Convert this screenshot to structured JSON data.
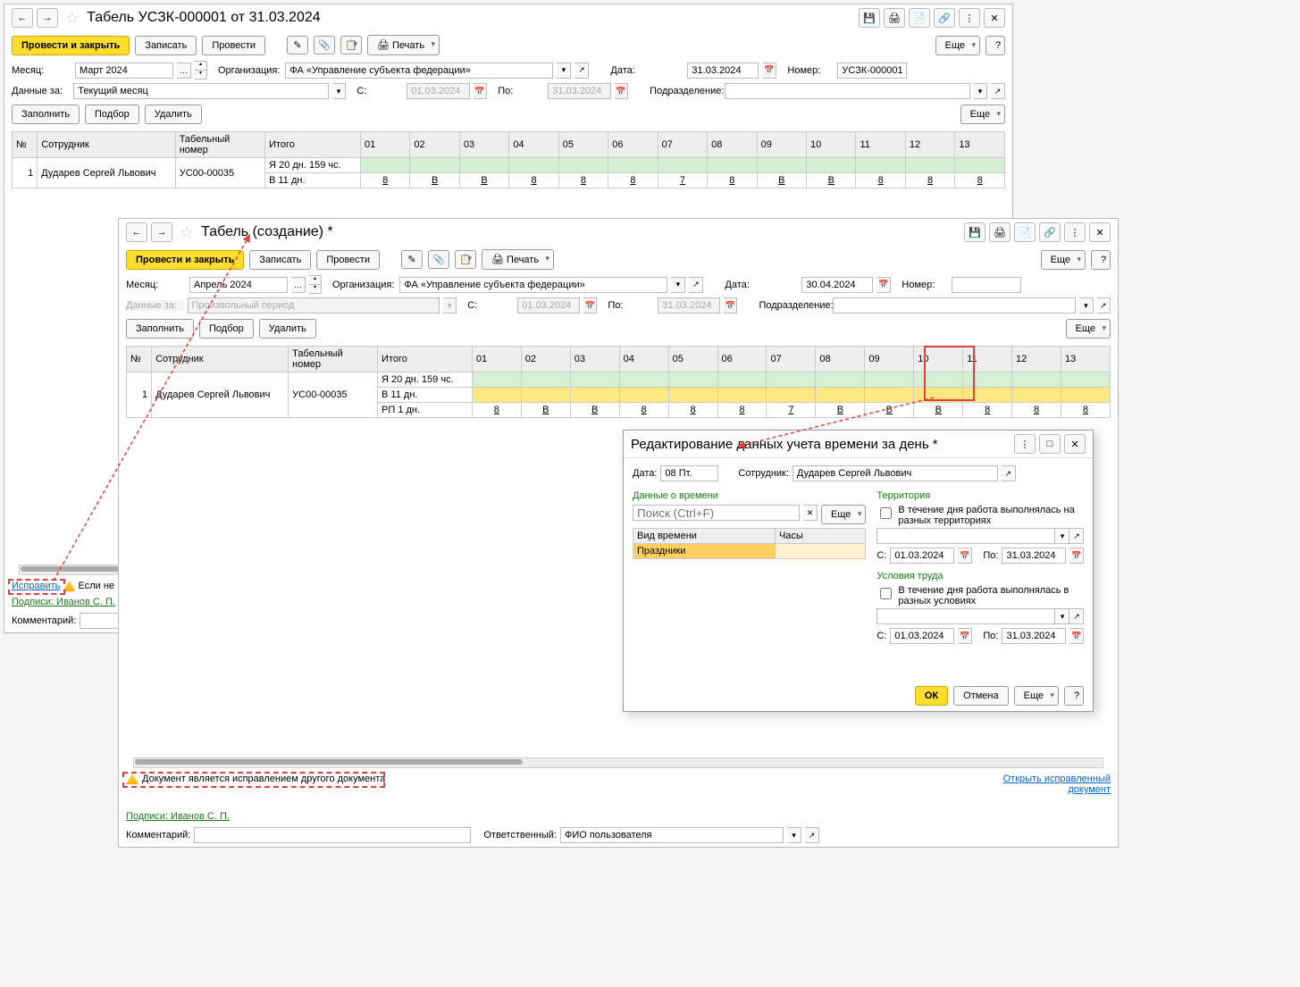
{
  "win1": {
    "title": "Табель УСЗК-000001 от 31.03.2024",
    "toolbar": {
      "post_close": "Провести и закрыть",
      "save": "Записать",
      "post": "Провести",
      "print": "Печать",
      "more": "Еще"
    },
    "form": {
      "month_label": "Месяц:",
      "month_value": "Март 2024",
      "org_label": "Организация:",
      "org_value": "ФА «Управление субъекта федерации»",
      "date_label": "Дата:",
      "date_value": "31.03.2024",
      "number_label": "Номер:",
      "number_value": "УСЗК-000001",
      "data_for_label": "Данные за:",
      "data_for_value": "Текущий месяц",
      "from_label": "С:",
      "from_value": "01.03.2024",
      "to_label": "По:",
      "to_value": "31.03.2024",
      "dept_label": "Подразделение:"
    },
    "tb2": {
      "fill": "Заполнить",
      "pick": "Подбор",
      "delete": "Удалить",
      "more": "Еще"
    },
    "grid": {
      "cols": {
        "n": "№",
        "emp": "Сотрудник",
        "tab": "Табельный номер",
        "sum": "Итого"
      },
      "days": [
        "01",
        "02",
        "03",
        "04",
        "05",
        "06",
        "07",
        "08",
        "09",
        "10",
        "11",
        "12",
        "13"
      ],
      "row": {
        "n": "1",
        "emp": "Дударев Сергей Львович",
        "tab": "УС00-00035",
        "sum1": "Я 20 дн. 159 чс.",
        "sum2": "В 11 дн.",
        "vals": [
          "8",
          "В",
          "В",
          "8",
          "8",
          "8",
          "7",
          "8",
          "В",
          "В",
          "8",
          "8",
          "8"
        ],
        "weekend_idx": [
          1,
          2,
          8,
          9
        ]
      }
    },
    "footer": {
      "fix": "Исправить",
      "warn": "Если не",
      "sign": "Подписи: Иванов С. П.",
      "comment_label": "Комментарий:"
    }
  },
  "win2": {
    "title": "Табель (создание) *",
    "toolbar": {
      "post_close": "Провести и закрыть",
      "save": "Записать",
      "post": "Провести",
      "print": "Печать",
      "more": "Еще"
    },
    "form": {
      "month_label": "Месяц:",
      "month_value": "Апрель 2024",
      "org_label": "Организация:",
      "org_value": "ФА «Управление субъекта федерации»",
      "date_label": "Дата:",
      "date_value": "30.04.2024",
      "number_label": "Номер:",
      "number_value": "",
      "data_for_label": "Данные за:",
      "data_for_value": "Произвольный период",
      "from_label": "С:",
      "from_value": "01.03.2024",
      "to_label": "По:",
      "to_value": "31.03.2024",
      "dept_label": "Подразделение:"
    },
    "tb2": {
      "fill": "Заполнить",
      "pick": "Подбор",
      "delete": "Удалить",
      "more": "Еще"
    },
    "grid": {
      "cols": {
        "n": "№",
        "emp": "Сотрудник",
        "tab": "Табельный номер",
        "sum": "Итого"
      },
      "days": [
        "01",
        "02",
        "03",
        "04",
        "05",
        "06",
        "07",
        "08",
        "09",
        "10",
        "11",
        "12",
        "13"
      ],
      "row": {
        "n": "1",
        "emp": "Дударев Сергей Львович",
        "tab": "УС00-00035",
        "sum1": "Я 20 дн. 159 чс.",
        "sum2": "В 11 дн.",
        "sum3": "РП 1 дн.",
        "vals": [
          "8",
          "В",
          "В",
          "8",
          "8",
          "8",
          "7",
          "В",
          "В",
          "В",
          "8",
          "8",
          "8"
        ],
        "weekend_idx": [
          1,
          2,
          8,
          9
        ],
        "highlight_idx": 7
      }
    },
    "footer": {
      "warn": "Документ является исправлением другого документа",
      "open_corr": "Открыть исправленный документ",
      "sign": "Подписи: Иванов С. П.",
      "comment_label": "Комментарий:",
      "resp_label": "Ответственный:",
      "resp_value": "ФИО пользователя"
    }
  },
  "modal": {
    "title": "Редактирование данных учета времени за день *",
    "date_label": "Дата:",
    "date_value": "08 Пт.",
    "emp_label": "Сотрудник:",
    "emp_value": "Дударев Сергей Львович",
    "time_section": "Данные о времени",
    "search_ph": "Поиск (Ctrl+F)",
    "more": "Еще",
    "col_type": "Вид времени",
    "col_hours": "Часы",
    "row_type": "Праздники",
    "terr_section": "Территория",
    "terr_check": "В течение дня работа выполнялась на разных территориях",
    "from_label": "С:",
    "from_value": "01.03.2024",
    "to_label": "По:",
    "to_value": "31.03.2024",
    "cond_section": "Условия труда",
    "cond_check": "В течение дня работа выполнялась в разных условиях",
    "from2_value": "01.03.2024",
    "to2_value": "31.03.2024",
    "ok": "ОК",
    "cancel": "Отмена",
    "more2": "Еще"
  }
}
